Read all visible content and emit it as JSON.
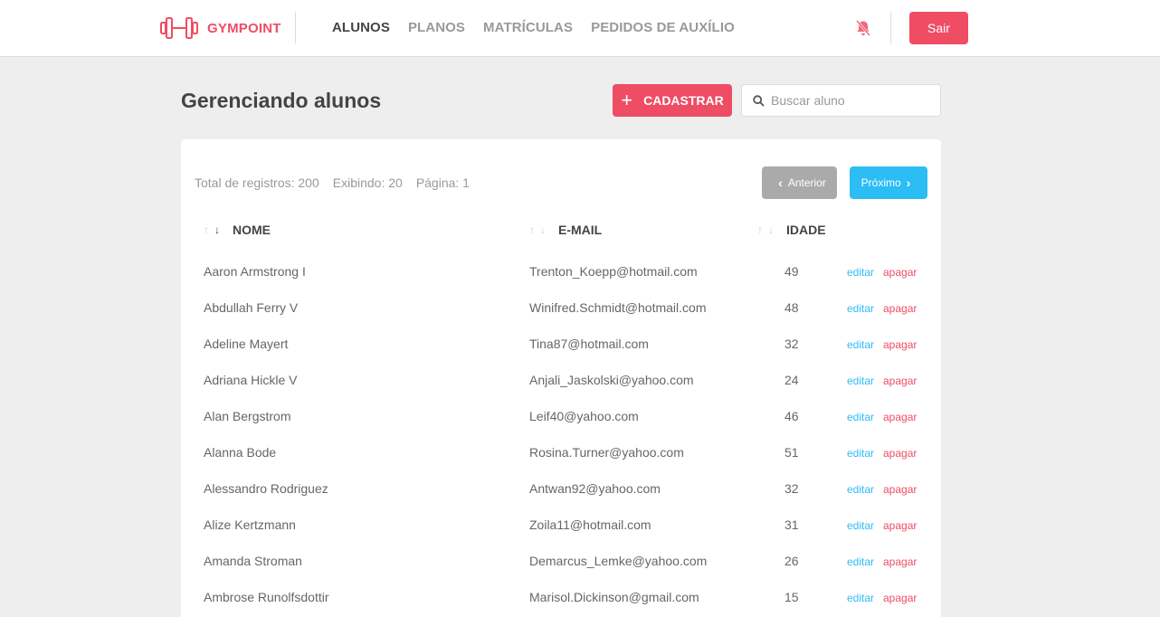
{
  "header": {
    "logo_text": "GYMPOINT",
    "nav": [
      {
        "label": "ALUNOS",
        "active": true
      },
      {
        "label": "PLANOS",
        "active": false
      },
      {
        "label": "MATRÍCULAS",
        "active": false
      },
      {
        "label": "PEDIDOS DE AUXÍLIO",
        "active": false
      }
    ],
    "logout_label": "Sair"
  },
  "page": {
    "title": "Gerenciando alunos",
    "add_label": "CADASTRAR",
    "search_placeholder": "Buscar aluno"
  },
  "pagination": {
    "total": "Total de registros: 200",
    "showing": "Exibindo: 20",
    "page": "Página: 1",
    "prev_label": "Anterior",
    "next_label": "Próximo"
  },
  "table": {
    "columns": [
      "NOME",
      "E-MAIL",
      "IDADE"
    ],
    "edit_label": "editar",
    "delete_label": "apagar",
    "rows": [
      {
        "name": "Aaron Armstrong I",
        "email": "Trenton_Koepp@hotmail.com",
        "age": "49"
      },
      {
        "name": "Abdullah Ferry V",
        "email": "Winifred.Schmidt@hotmail.com",
        "age": "48"
      },
      {
        "name": "Adeline Mayert",
        "email": "Tina87@hotmail.com",
        "age": "32"
      },
      {
        "name": "Adriana Hickle V",
        "email": "Anjali_Jaskolski@yahoo.com",
        "age": "24"
      },
      {
        "name": "Alan Bergstrom",
        "email": "Leif40@yahoo.com",
        "age": "46"
      },
      {
        "name": "Alanna Bode",
        "email": "Rosina.Turner@yahoo.com",
        "age": "51"
      },
      {
        "name": "Alessandro Rodriguez",
        "email": "Antwan92@yahoo.com",
        "age": "32"
      },
      {
        "name": "Alize Kertzmann",
        "email": "Zoila11@hotmail.com",
        "age": "31"
      },
      {
        "name": "Amanda Stroman",
        "email": "Demarcus_Lemke@yahoo.com",
        "age": "26"
      },
      {
        "name": "Ambrose Runolfsdottir",
        "email": "Marisol.Dickinson@gmail.com",
        "age": "15"
      }
    ]
  },
  "colors": {
    "brand": "#ee4d64",
    "info": "#2cbdf5",
    "disabled": "#aaaaaa",
    "background": "#eeeeee"
  },
  "icons": [
    "dumbbell-logo-icon",
    "bell-off-icon",
    "plus-icon",
    "search-icon",
    "chevron-left-icon",
    "chevron-right-icon",
    "arrow-up-icon",
    "arrow-down-icon"
  ]
}
